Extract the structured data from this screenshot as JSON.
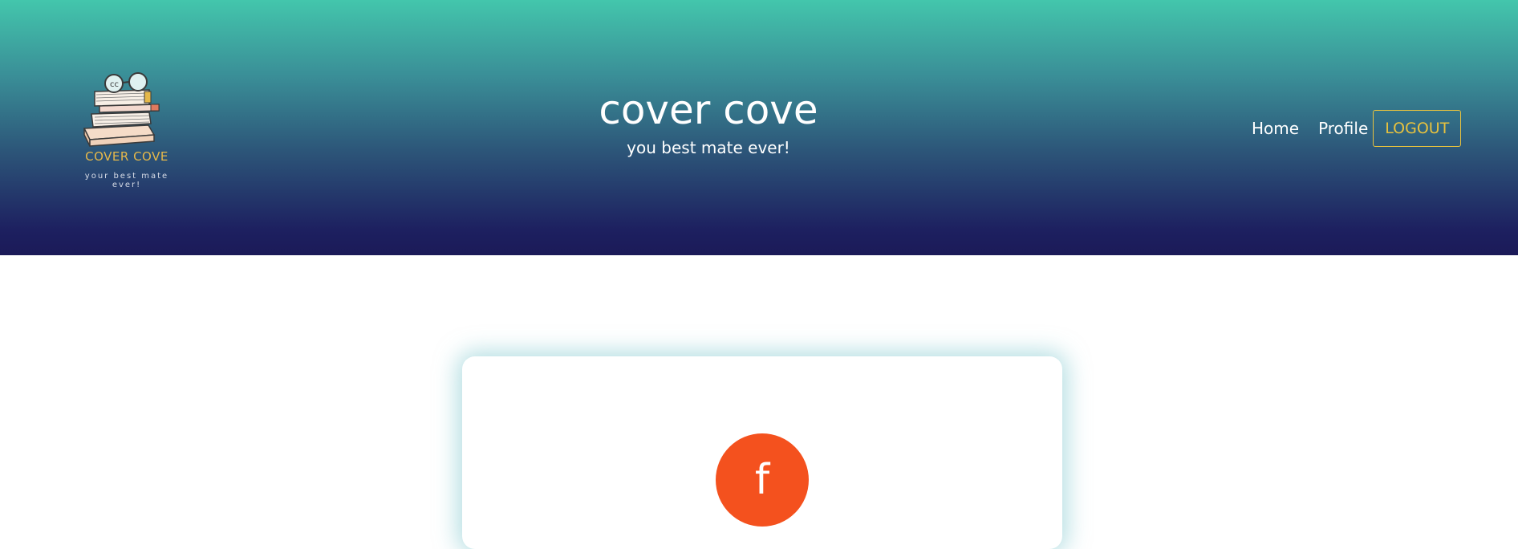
{
  "logo": {
    "title": "COVER COVE",
    "tagline": "your best mate ever!"
  },
  "header": {
    "title": "cover cove",
    "subtitle": "you best mate ever!"
  },
  "nav": {
    "home": "Home",
    "profile": "Profile",
    "logout": "LOGOUT"
  },
  "profile_card": {
    "avatar_initial": "f"
  },
  "colors": {
    "header_top": "#43c6ac",
    "header_bottom": "#1b1a58",
    "accent_gold": "#e8c23e",
    "avatar_bg": "#f4511e"
  }
}
